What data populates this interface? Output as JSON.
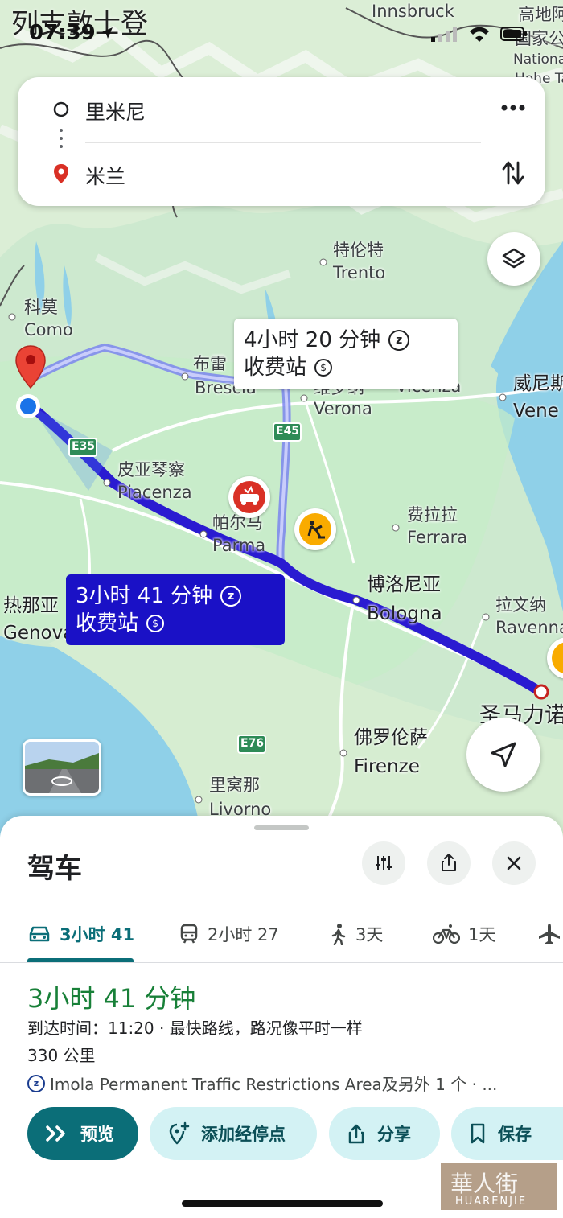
{
  "status_bar": {
    "time": "07:39"
  },
  "map_overlay_title": "列支敦士登",
  "route_inputs": {
    "origin": "里米尼",
    "destination": "米兰",
    "more_icon": "more-vert-icon",
    "swap_icon": "swap-vert-icon"
  },
  "map_labels": {
    "innsbruck": "Innsbruck",
    "high_land": "高地阿",
    "national_park": "国家公",
    "national": "National",
    "hohe": "Hohe Ta",
    "trento_cn": "特伦特",
    "trento": "Trento",
    "como_cn": "科莫",
    "como": "Como",
    "brescia_cn": "布雷",
    "brescia": "Brescia",
    "verona_cn": "维罗纳",
    "verona": "Verona",
    "vicenza": "Vicenza",
    "venice_cn": "威尼斯",
    "venice": "Vene",
    "piacenza_cn": "皮亚琴察",
    "piacenza": "Piacenza",
    "parma_cn": "帕尔马",
    "parma": "Parma",
    "ferrara_cn": "费拉拉",
    "ferrara": "Ferrara",
    "bologna_cn": "博洛尼亚",
    "bologna": "Bologna",
    "ravenna_cn": "拉文纳",
    "ravenna": "Ravenna",
    "genova_cn": "热那亚",
    "genova": "Genova",
    "sanmarino_cn": "圣马力诺",
    "firenze_cn": "佛罗伦萨",
    "firenze": "Firenze",
    "livorno_cn": "里窝那",
    "livorno": "Livorno",
    "road_e35": "E35",
    "road_e45": "E45",
    "road_e76": "E76"
  },
  "route_callouts": {
    "alternate": {
      "duration": "4小时 20 分钟",
      "toll": "收费站"
    },
    "main": {
      "duration": "3小时 41 分钟",
      "toll": "收费站"
    }
  },
  "sheet": {
    "title": "驾车",
    "tabs": [
      {
        "icon": "car-icon",
        "label": "3小时 41",
        "active": true
      },
      {
        "icon": "train-icon",
        "label": "2小时 27"
      },
      {
        "icon": "walk-icon",
        "label": "3天"
      },
      {
        "icon": "bike-icon",
        "label": "1天"
      },
      {
        "icon": "flight-icon",
        "label": ""
      }
    ],
    "duration": "3小时 41 分钟",
    "arrival": "到达时间：11:20 · 最快路线，路况像平时一样",
    "distance": "330 公里",
    "restriction": "Imola Permanent Traffic Restrictions Area及另外 1 个 · ...",
    "actions": {
      "preview": "预览",
      "add_stop": "添加经停点",
      "share": "分享",
      "save": "保存"
    }
  },
  "watermark": "HUARENJIE",
  "colors": {
    "route_main": "#2a1bd1",
    "route_alt": "#9aa6f5",
    "accent_teal": "#0b6e78",
    "duration_green": "#188038"
  }
}
